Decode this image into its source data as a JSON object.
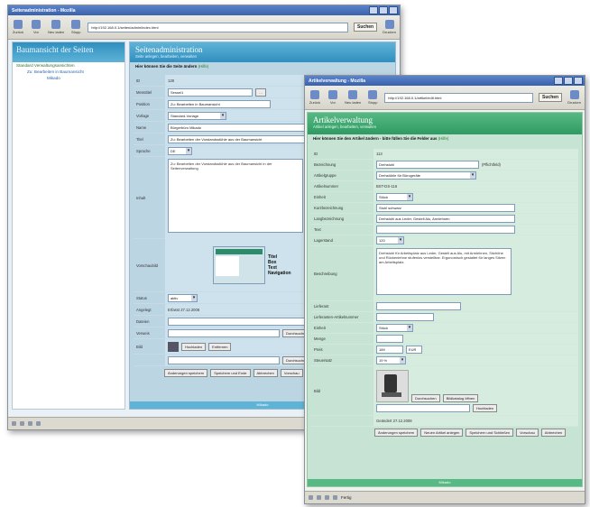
{
  "win1": {
    "title": "Seitenadministration - Mozilla",
    "toolbar": {
      "back": "Zurück",
      "forward": "Vor",
      "reload": "Neu laden",
      "stop": "Stopp",
      "url": "http://192.168.0.1/seiten/admin/index.html",
      "search": "Suchen",
      "print": "Drucken"
    },
    "tree": {
      "title": "Baumansicht der Seiten",
      "items": [
        "Standard Verwaltungsansichten",
        "Zu: Bearbeiten in Baumansicht",
        "Mikado"
      ]
    },
    "main": {
      "title": "Seitenadministration",
      "subtitle": "Seite anlegen, bearbeiten, verwalten",
      "hint": "Hier können Sie die Seite ändern",
      "hint_extra": "(Hilfe)",
      "fields": [
        {
          "label": "ID",
          "value": "128"
        },
        {
          "label": "Menütitel",
          "value": "Sessel1"
        },
        {
          "label": "Position",
          "value": "Zu: Bearbeiten in Baumansicht"
        },
        {
          "label": "Vorlage",
          "value": "Standard-Vorlage"
        },
        {
          "label": "Name",
          "value": "Bürgerbüro Mikado"
        },
        {
          "label": "Titel",
          "value": "Zu: Bearbeiten der Vorstandsstühle aus der Baumansicht"
        },
        {
          "label": "Sprache",
          "value": "DE"
        },
        {
          "label": "Inhalt",
          "value": "Zu: Bearbeiten der Vorstandsstühle aus der Baumansicht in der Seitenverwaltung"
        },
        {
          "label": "Vorschaubild",
          "value": ""
        },
        {
          "label": "Status",
          "value": "aktiv"
        },
        {
          "label": "Angelegt",
          "value": "Erfasst 27.12.2008"
        },
        {
          "label": "Dateien",
          "value": ""
        },
        {
          "label": "Verweis",
          "value": ""
        },
        {
          "label": "Bild",
          "value": ""
        }
      ],
      "preview_labels": [
        "Titel",
        "Box",
        "Text",
        "Navigation"
      ],
      "buttons": [
        "Durchsuchen",
        "Hochladen",
        "Entfernen",
        "Änderungen speichern",
        "Speichern und Ende",
        "Abbrechen",
        "Vorschau",
        "Löschen",
        "Neu anlegen"
      ],
      "footer": "Mikado"
    }
  },
  "win2": {
    "title": "Artikelverwaltung - Mozilla",
    "toolbar": {
      "back": "Zurück",
      "forward": "Vor",
      "reload": "Neu laden",
      "stop": "Stopp",
      "url": "http://192.168.0.1/artikel/edit.html",
      "search": "Suchen",
      "print": "Drucken"
    },
    "main": {
      "title": "Artikelverwaltung",
      "subtitle": "Artikel anlegen, bearbeiten, verwalten",
      "hint": "Hier können Sie den Artikel ändern - bitte füllen Sie die Felder aus",
      "hint_extra": "(Hilfe)",
      "fields": [
        {
          "label": "ID",
          "value": "113"
        },
        {
          "label": "Bezeichnung",
          "value": "Drehstuhl",
          "note": "(Pflichtfeld)"
        },
        {
          "label": "Artikelgruppe",
          "value": "Drehstühle für Bürogeräte"
        },
        {
          "label": "Artikelnummer",
          "value": "BST-DS-116"
        },
        {
          "label": "Einheit",
          "value": "Stück"
        },
        {
          "label": "Kurzbezeichnung",
          "value": "Stuhl schwarz"
        },
        {
          "label": "Langbezeichnung",
          "value": "Drehstuhl aus Leder, Gestell Alu, Armlehnen"
        },
        {
          "label": "Text",
          "value": ""
        },
        {
          "label": "Lagerstand",
          "value": "120"
        },
        {
          "label": "Beschreibung",
          "value": "Drehstuhl für Arbeitsplatz aus Leder, Gestell aus Alu, mit Armlehnen, Sitzhöhe und Rückenlehne stufenlos verstellbar. Ergonomisch gestaltet für langes Sitzen am Arbeitsplatz."
        },
        {
          "label": "Lieferant",
          "value": ""
        },
        {
          "label": "Lieferanten-Artikelnummer",
          "value": ""
        },
        {
          "label": "Einheit",
          "value": "Stück"
        },
        {
          "label": "Menge",
          "value": ""
        },
        {
          "label": "Preis",
          "value": "189",
          "value2": "EUR"
        },
        {
          "label": "Steuersatz",
          "value": "19 %"
        },
        {
          "label": "Bild",
          "value": ""
        },
        {
          "label": "Geändert",
          "value": "Geändert 27.12.2008"
        }
      ],
      "image_buttons": [
        "Durchsuchen",
        "Bildkatalog öffnen",
        "Hochladen"
      ],
      "buttons": [
        "Änderungen speichern",
        "Neuen Artikel anlegen",
        "Speichern und Schließen",
        "Vorschau",
        "Abbrechen",
        "Löschen"
      ],
      "footer": "Mikado"
    }
  },
  "status": {
    "text": "Fertig",
    "zoom": "100%"
  },
  "colors": {
    "blue_header": "#2f8fbf",
    "green_header": "#2f9a63",
    "form_blue": "#bcd5e3",
    "form_green": "#c6e3d3"
  }
}
